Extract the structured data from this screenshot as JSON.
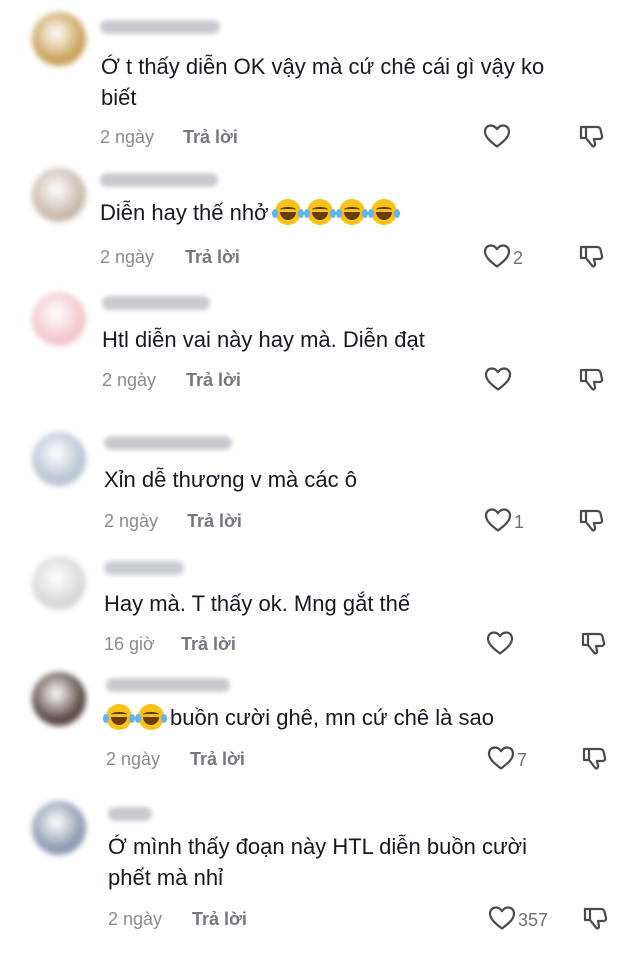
{
  "comments": [
    {
      "username": "Sinh ra để cà",
      "text_lines": [
        "Ớ t thấy diễn OK vậy mà cứ chê cái gì vậy ko",
        "biết"
      ],
      "emojis_before": 0,
      "emojis_after": 0,
      "time": "2 ngày",
      "reply_label": "Trả lời",
      "likes": "",
      "avatar_color": "#c9a25a"
    },
    {
      "username": "huyenbi1112",
      "text_lines": [
        "Diễn hay thế nhở"
      ],
      "emojis_before": 0,
      "emojis_after": 4,
      "time": "2 ngày",
      "reply_label": "Trả lời",
      "likes": "2",
      "avatar_color": "#c8b8aa"
    },
    {
      "username": "Nguyễn Hà",
      "text_lines": [
        "Htl diễn vai này hay mà. Diễn đạt"
      ],
      "emojis_before": 0,
      "emojis_after": 0,
      "time": "2 ngày",
      "reply_label": "Trả lời",
      "likes": "",
      "avatar_color": "#f2c6cc"
    },
    {
      "username": "My Siro Soda",
      "text_lines": [
        "Xỉn dễ thương v mà các ô"
      ],
      "emojis_before": 0,
      "emojis_after": 0,
      "time": "2 ngày",
      "reply_label": "Trả lời",
      "likes": "1",
      "avatar_color": "#b9c3d3"
    },
    {
      "username": "Bê Tê Tê",
      "text_lines": [
        "Hay mà. T thấy ok. Mng gắt thế"
      ],
      "emojis_before": 0,
      "emojis_after": 0,
      "time": "16 giờ",
      "reply_label": "Trả lời",
      "likes": "",
      "avatar_color": "#d7d7d9"
    },
    {
      "username": "My của Phào",
      "text_lines": [
        "buồn cười ghê, mn cứ chê là sao"
      ],
      "emojis_before": 2,
      "emojis_after": 0,
      "time": "2 ngày",
      "reply_label": "Trả lời",
      "likes": "7",
      "avatar_color": "#5b4a47"
    },
    {
      "username": "Chip",
      "text_lines": [
        "Ớ mình thấy đoạn này HTL diễn buồn cười",
        "phết mà nhỉ"
      ],
      "emojis_before": 0,
      "emojis_after": 0,
      "time": "2 ngày",
      "reply_label": "Trả lời",
      "likes": "357",
      "avatar_color": "#8d9ab0"
    }
  ]
}
